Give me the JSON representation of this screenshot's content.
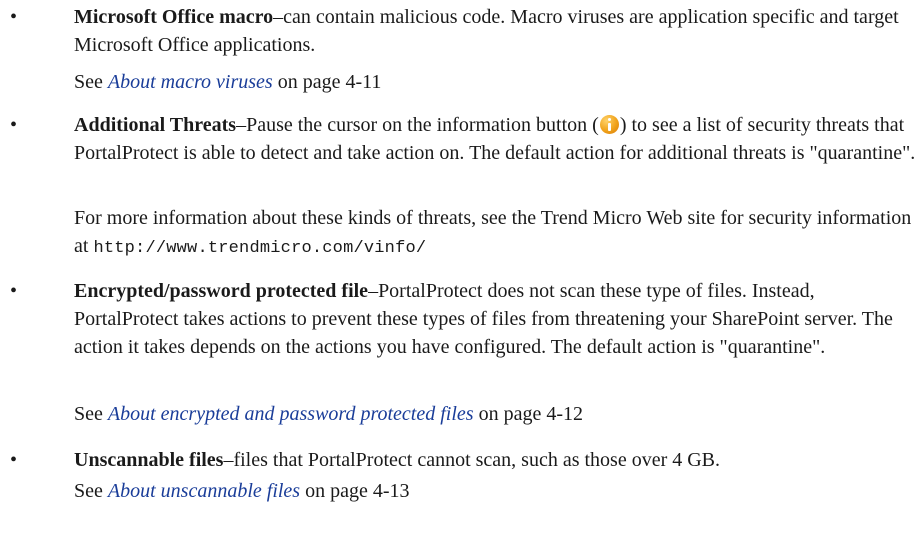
{
  "items": [
    {
      "bullet": "•",
      "term": "Microsoft Office macro",
      "text": "–can contain malicious code. Macro viruses are application specific and target Microsoft Office applications.",
      "see_prefix": "See ",
      "link": "About macro viruses",
      "see_suffix": " on page 4-11"
    },
    {
      "bullet": "•",
      "term": "Additional Threats",
      "text_a": "–Pause the cursor on the information button (",
      "icon": "info-icon",
      "text_b": ") to see a list of security threats that PortalProtect is able to detect and take action on. The default action for additional threats is \"quarantine\".",
      "more_info": "For more information about these kinds of threats, see the Trend Micro Web site for security information at",
      "url": "http://www.trendmicro.com/vinfo/"
    },
    {
      "bullet": "•",
      "term": "Encrypted/password protected file",
      "text": "–PortalProtect does not scan these type of files. Instead, PortalProtect takes actions to prevent these types of files from threatening your SharePoint server. The action it takes depends on the actions you have configured. The default action is \"quarantine\".",
      "see_prefix": "See ",
      "link": "About encrypted and password protected files",
      "see_suffix": " on page 4-12"
    },
    {
      "bullet": "•",
      "term": "Unscannable files",
      "text": "–files that PortalProtect cannot scan, such as those over 4 GB.",
      "see_prefix": "See ",
      "link": "About unscannable files",
      "see_suffix": " on page 4-13"
    }
  ]
}
